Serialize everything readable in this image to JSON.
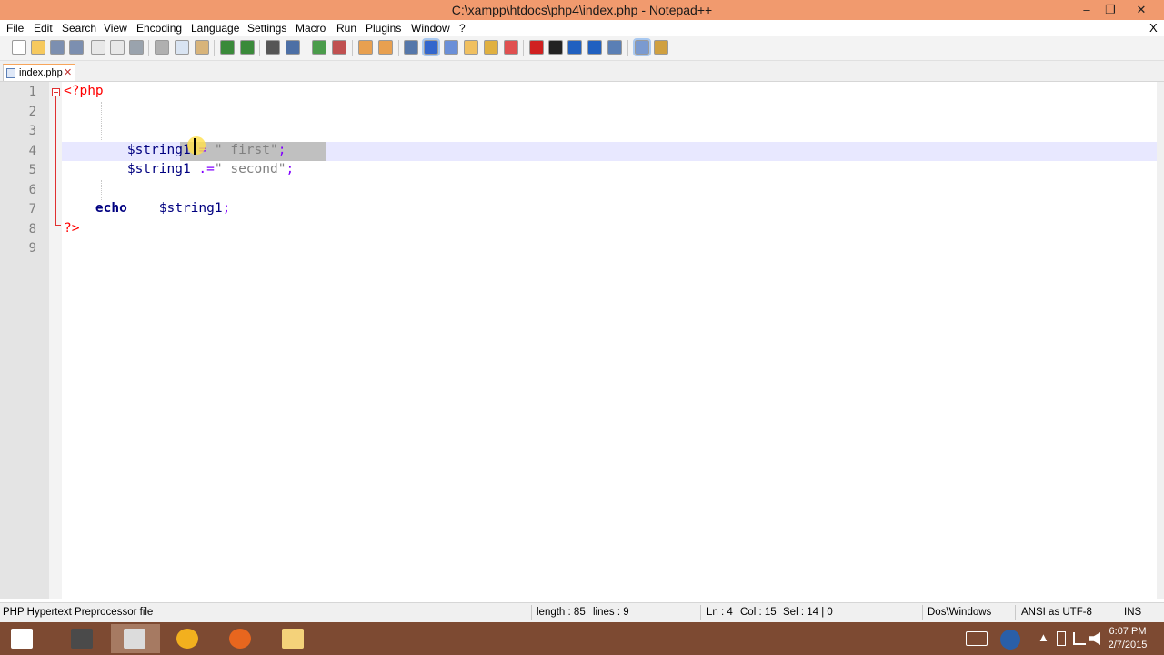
{
  "window": {
    "title": "C:\\xampp\\htdocs\\php4\\index.php - Notepad++",
    "minimize": "–",
    "maximize": "❐",
    "close": "✕"
  },
  "menu": {
    "items": [
      "File",
      "Edit",
      "Search",
      "View",
      "Encoding",
      "Language",
      "Settings",
      "Macro",
      "Run",
      "Plugins",
      "Window",
      "?"
    ],
    "close_doc": "X"
  },
  "toolbar": {
    "buttons": [
      {
        "name": "new-file-icon",
        "color": "#ffffff"
      },
      {
        "name": "open-file-icon",
        "color": "#f6c95e"
      },
      {
        "name": "save-icon",
        "color": "#7c8fb0"
      },
      {
        "name": "save-all-icon",
        "color": "#7c8fb0"
      },
      {
        "name": "close-icon",
        "color": "#e8e8e8"
      },
      {
        "name": "close-all-icon",
        "color": "#e8e8e8"
      },
      {
        "name": "print-icon",
        "color": "#9aa3ad"
      },
      {
        "name": "cut-icon",
        "color": "#b0b0b0"
      },
      {
        "name": "copy-icon",
        "color": "#d9e4f2"
      },
      {
        "name": "paste-icon",
        "color": "#d8b47a"
      },
      {
        "name": "undo-icon",
        "color": "#3a8a3a"
      },
      {
        "name": "redo-icon",
        "color": "#3a8a3a"
      },
      {
        "name": "find-icon",
        "color": "#555555"
      },
      {
        "name": "replace-icon",
        "color": "#4c6fa5"
      },
      {
        "name": "zoom-in-icon",
        "color": "#4b9c4b"
      },
      {
        "name": "zoom-out-icon",
        "color": "#c05050"
      },
      {
        "name": "sync-vertical-icon",
        "color": "#e8a050"
      },
      {
        "name": "sync-horizontal-icon",
        "color": "#e8a050"
      },
      {
        "name": "word-wrap-icon",
        "color": "#5577aa"
      },
      {
        "name": "show-all-chars-icon",
        "color": "#3366cc"
      },
      {
        "name": "indent-guide-icon",
        "color": "#6a8fd8"
      },
      {
        "name": "user-language-icon",
        "color": "#f0c060"
      },
      {
        "name": "document-map-icon",
        "color": "#e0b040"
      },
      {
        "name": "function-list-icon",
        "color": "#e05050"
      },
      {
        "name": "record-macro-icon",
        "color": "#d02020"
      },
      {
        "name": "stop-record-icon",
        "color": "#222222"
      },
      {
        "name": "playback-icon",
        "color": "#2060c0"
      },
      {
        "name": "run-multiple-macro-icon",
        "color": "#2060c0"
      },
      {
        "name": "save-macro-icon",
        "color": "#5a7fb5"
      },
      {
        "name": "spell-check-icon",
        "color": "#7a9ad0"
      },
      {
        "name": "plugin-tool-icon",
        "color": "#d0a040"
      }
    ]
  },
  "tab": {
    "label": "index.php",
    "close": "✕"
  },
  "editor": {
    "line_numbers": [
      "1",
      "2",
      "3",
      "4",
      "5",
      "6",
      "7",
      "8",
      "9"
    ],
    "lines": [
      [
        {
          "t": "<?php",
          "c": "c-tag"
        }
      ],
      [],
      [],
      [
        {
          "t": "        "
        },
        {
          "t": "$string1",
          "c": "c-var"
        },
        {
          "t": " "
        },
        {
          "t": "=",
          "c": "c-op"
        },
        {
          "t": " "
        },
        {
          "t": "\" first\"",
          "c": "c-str"
        },
        {
          "t": ";",
          "c": "c-op"
        }
      ],
      [
        {
          "t": "        "
        },
        {
          "t": "$string1",
          "c": "c-var"
        },
        {
          "t": " "
        },
        {
          "t": ".=",
          "c": "c-op"
        },
        {
          "t": "\" second\"",
          "c": "c-str"
        },
        {
          "t": ";",
          "c": "c-op"
        }
      ],
      [],
      [
        {
          "t": "    "
        },
        {
          "t": "echo",
          "c": "c-kw"
        },
        {
          "t": "    "
        },
        {
          "t": "$string1",
          "c": "c-var"
        },
        {
          "t": ";",
          "c": "c-op"
        }
      ],
      [
        {
          "t": "?>",
          "c": "c-tag"
        }
      ],
      []
    ]
  },
  "status": {
    "file_type": "PHP Hypertext Preprocessor file",
    "length": "length : 85",
    "lines": "lines : 9",
    "ln": "Ln : 4",
    "col": "Col : 15",
    "sel": "Sel : 14 | 0",
    "eol": "Dos\\Windows",
    "encoding": "ANSI as UTF-8",
    "mode": "INS"
  },
  "taskbar": {
    "apps": [
      {
        "name": "start-button",
        "color": "#ffffff",
        "active": false
      },
      {
        "name": "taskbar-app-sublime",
        "color": "#4a4a4a",
        "active": false
      },
      {
        "name": "taskbar-app-notepadpp",
        "color": "#dcdcdc",
        "active": true
      },
      {
        "name": "taskbar-app-chrome",
        "color": "#f2b01e",
        "active": false
      },
      {
        "name": "taskbar-app-firefox",
        "color": "#e8661e",
        "active": false
      },
      {
        "name": "taskbar-app-explorer",
        "color": "#f4d27a",
        "active": false
      }
    ],
    "time": "6:07 PM",
    "date": "2/7/2015"
  }
}
